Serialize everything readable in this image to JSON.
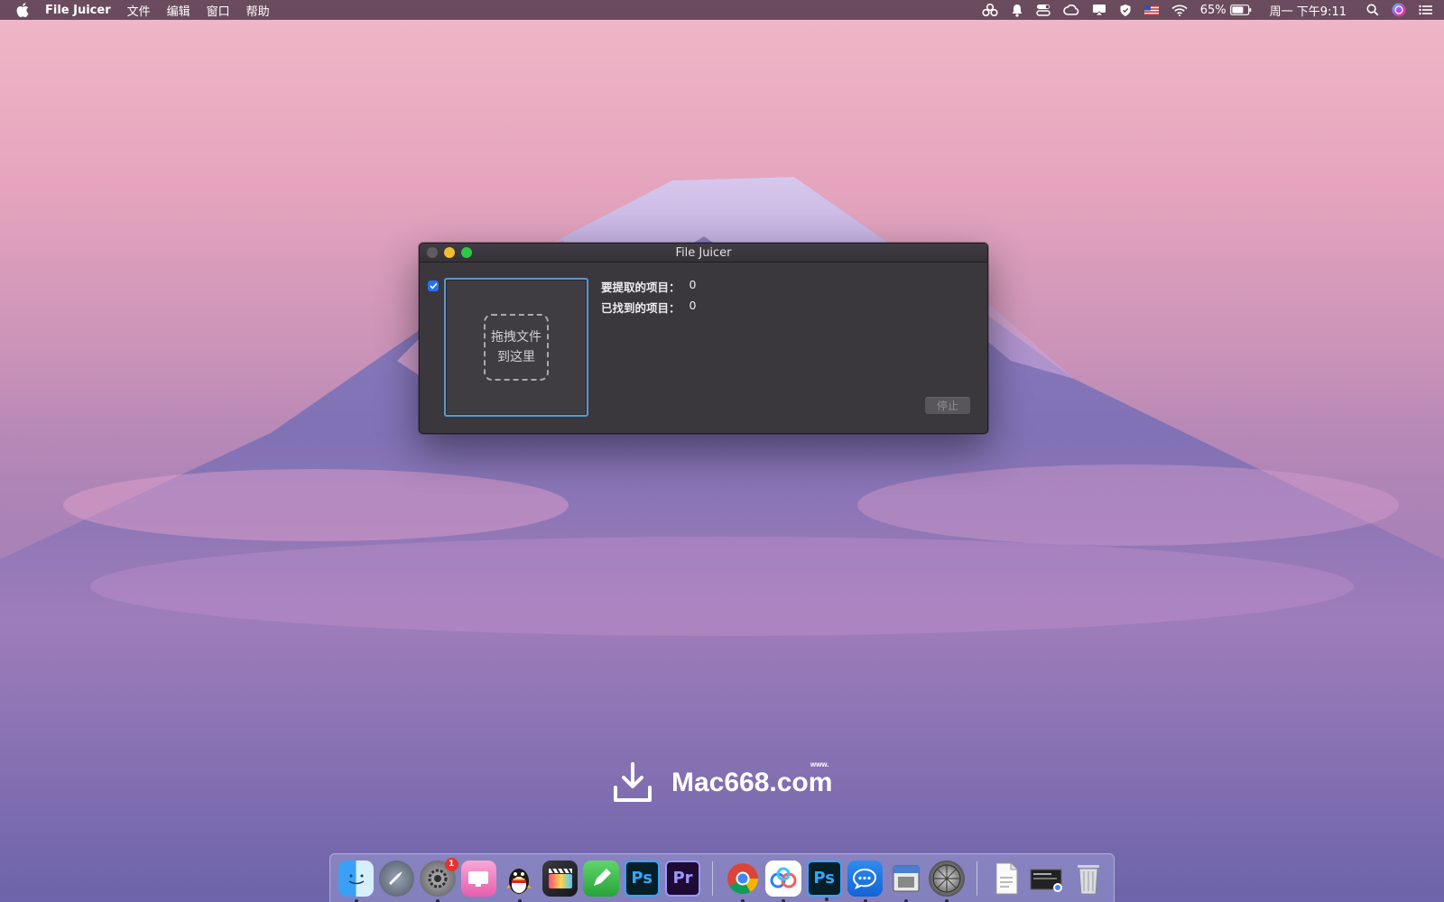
{
  "menubar": {
    "app_name": "File Juicer",
    "menus": [
      "文件",
      "编辑",
      "窗口",
      "帮助"
    ],
    "battery": "65%",
    "clock": "周一 下午9:11"
  },
  "window": {
    "title": "File Juicer",
    "checkbox_checked": true,
    "dropzone_line1": "拖拽文件",
    "dropzone_line2": "到这里",
    "stats": [
      {
        "label": "要提取的项目：",
        "value": "0"
      },
      {
        "label": "已找到的项目：",
        "value": "0"
      }
    ],
    "stop_button": "停止"
  },
  "watermark": {
    "www": "www.",
    "text": "Mac668.com"
  },
  "dock": {
    "badge_count": "1",
    "ps_label": "Ps",
    "pr_label": "Pr"
  }
}
